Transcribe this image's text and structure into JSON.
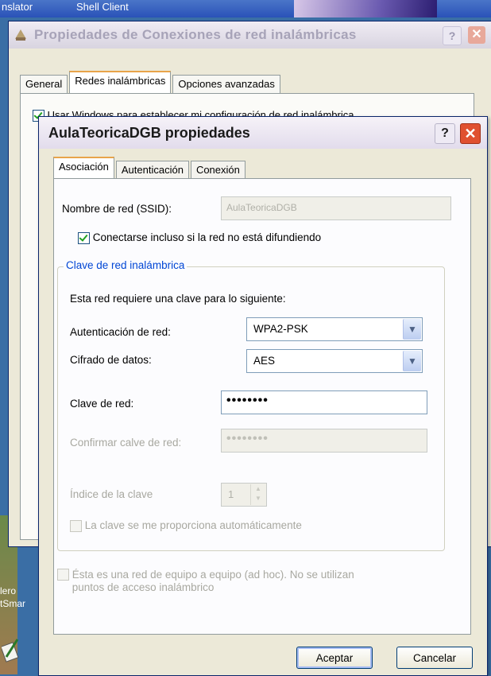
{
  "taskbar": {
    "left_item": "nslator",
    "shell_item": "Shell Client"
  },
  "desktop": {
    "icon_label_1": "lero",
    "icon_label_2": "tSmar"
  },
  "outer_window": {
    "title": "Propiedades de Conexiones de red inalámbricas",
    "help_label": "?",
    "close_label": "✕",
    "tabs": [
      {
        "label": "General",
        "active": false
      },
      {
        "label": "Redes inalámbricas",
        "active": true
      },
      {
        "label": "Opciones avanzadas",
        "active": false
      }
    ],
    "checkbox_label": "Usar Windows para establecer mi configuración de red inalámbrica"
  },
  "dialog": {
    "title": "AulaTeoricaDGB propiedades",
    "help_label": "?",
    "close_label": "✕",
    "tabs": [
      {
        "label": "Asociación",
        "active": true
      },
      {
        "label": "Autenticación",
        "active": false
      },
      {
        "label": "Conexión",
        "active": false
      }
    ],
    "ssid_label": "Nombre de red (SSID):",
    "ssid_value": "AulaTeoricaDGB",
    "broadcast_checkbox": {
      "label": "Conectarse incluso si la red no está difundiendo",
      "checked": true
    },
    "key_group": {
      "title": "Clave de red inalámbrica",
      "intro": "Esta red requiere una clave para lo siguiente:",
      "auth_label": "Autenticación de red:",
      "auth_value": "WPA2-PSK",
      "cipher_label": "Cifrado de datos:",
      "cipher_value": "AES",
      "key_label": "Clave de red:",
      "key_value": "••••••••",
      "confirm_label": "Confirmar calve de red:",
      "confirm_value": "••••••••",
      "index_label": "Índice de la clave",
      "index_value": "1",
      "auto_key_label": "La clave se me proporciona automáticamente"
    },
    "adhoc_label_line1": "Ésta es una red de equipo a equipo (ad hoc). No se utilizan",
    "adhoc_label_line2": "puntos de acceso inalámbrico",
    "ok_label": "Aceptar",
    "cancel_label": "Cancelar"
  }
}
